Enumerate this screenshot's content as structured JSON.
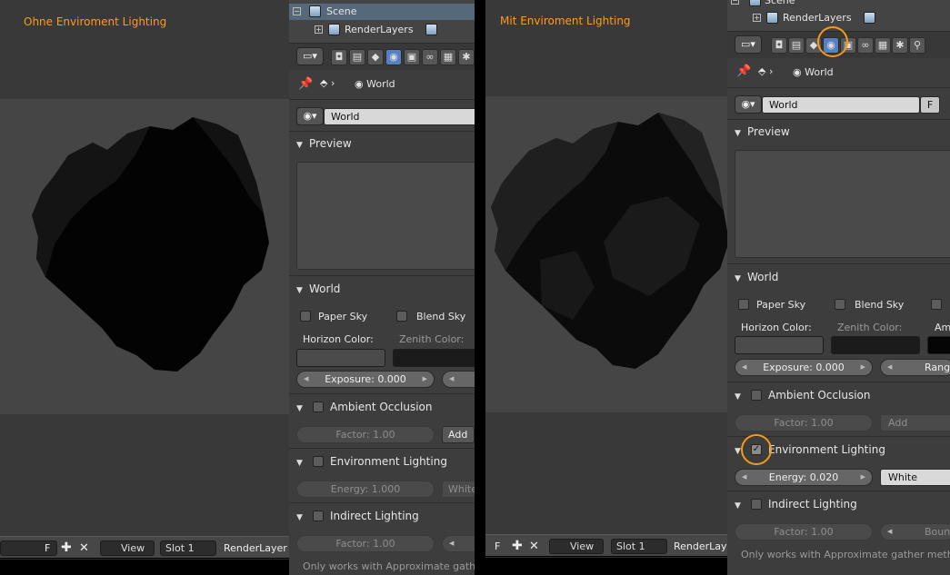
{
  "left": {
    "viewport_title": "Ohne Enviroment Lighting",
    "header": {
      "f_label": "F",
      "plus_icon": "plus-icon",
      "x_icon": "x-icon",
      "view_label": "View",
      "slot_label": "Slot 1",
      "layer_label": "RenderLayer"
    },
    "outliner": {
      "scene": "Scene",
      "renderlayers": "RenderLayers"
    },
    "breadcrumb": "World",
    "world_field": "World",
    "panels": {
      "preview": "Preview",
      "world": "World",
      "paper_sky": "Paper Sky",
      "blend_sky": "Blend Sky",
      "horizon_color": "Horizon Color:",
      "zenith_color": "Zenith Color:",
      "exposure": "Exposure: 0.000",
      "ao_title": "Ambient Occlusion",
      "ao_factor": "Factor: 1.00",
      "ao_add": "Add",
      "env_title": "Environment Lighting",
      "env_energy": "Energy: 1.000",
      "env_color": "White",
      "indirect_title": "Indirect Lighting",
      "indirect_factor": "Factor: 1.00",
      "note": "Only works with Approximate gather"
    }
  },
  "right": {
    "viewport_title": "Mit Enviroment Lighting",
    "header": {
      "f_label": "F",
      "plus_icon": "plus-icon",
      "x_icon": "x-icon",
      "view_label": "View",
      "slot_label": "Slot 1",
      "layer_label": "RenderLaye"
    },
    "outliner": {
      "scene": "Scene",
      "renderlayers": "RenderLayers"
    },
    "breadcrumb": "World",
    "world_field": "World",
    "world_field_f": "F",
    "panels": {
      "preview": "Preview",
      "world": "World",
      "paper_sky": "Paper Sky",
      "blend_sky": "Blend Sky",
      "horizon_color": "Horizon Color:",
      "zenith_color": "Zenith Color:",
      "ambient_color": "Am",
      "exposure": "Exposure: 0.000",
      "range": "Range:",
      "ao_title": "Ambient Occlusion",
      "ao_factor": "Factor: 1.00",
      "ao_add": "Add",
      "env_title": "Environment Lighting",
      "env_energy": "Energy: 0.020",
      "env_color": "White",
      "indirect_title": "Indirect Lighting",
      "indirect_factor": "Factor: 1.00",
      "bounces": "Bounce",
      "note": "Only works with Approximate gather method"
    }
  },
  "colors": {
    "highlight": "#f39a1b",
    "title_orange": "#ff9a1f",
    "active_tab": "#5680c2",
    "horizon_swatch": "#4b4b4b",
    "zenith_swatch": "#1b1b1b"
  }
}
